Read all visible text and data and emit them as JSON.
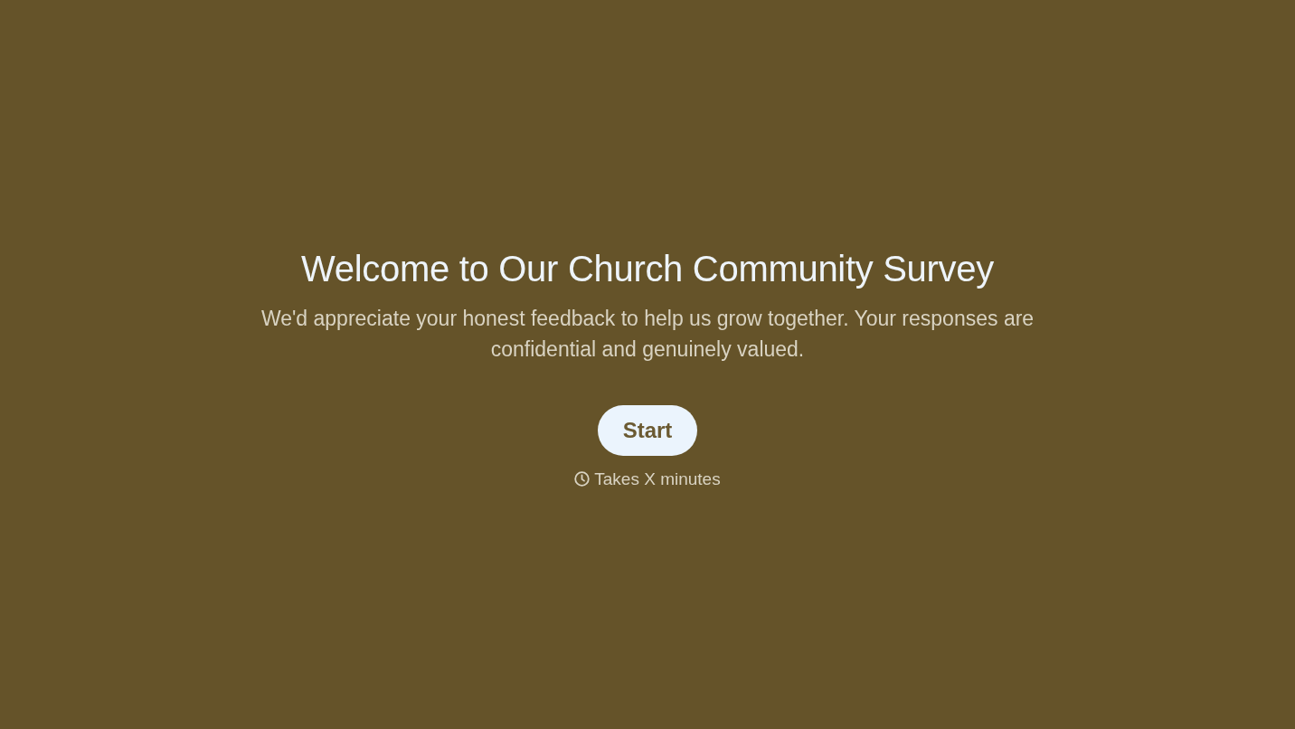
{
  "title": "Welcome to Our Church Community Survey",
  "subtitle": "We'd appreciate your honest feedback to help us grow together. Your responses are confidential and genuinely valued.",
  "start_button": {
    "label": "Start"
  },
  "duration_note": "Takes X minutes"
}
